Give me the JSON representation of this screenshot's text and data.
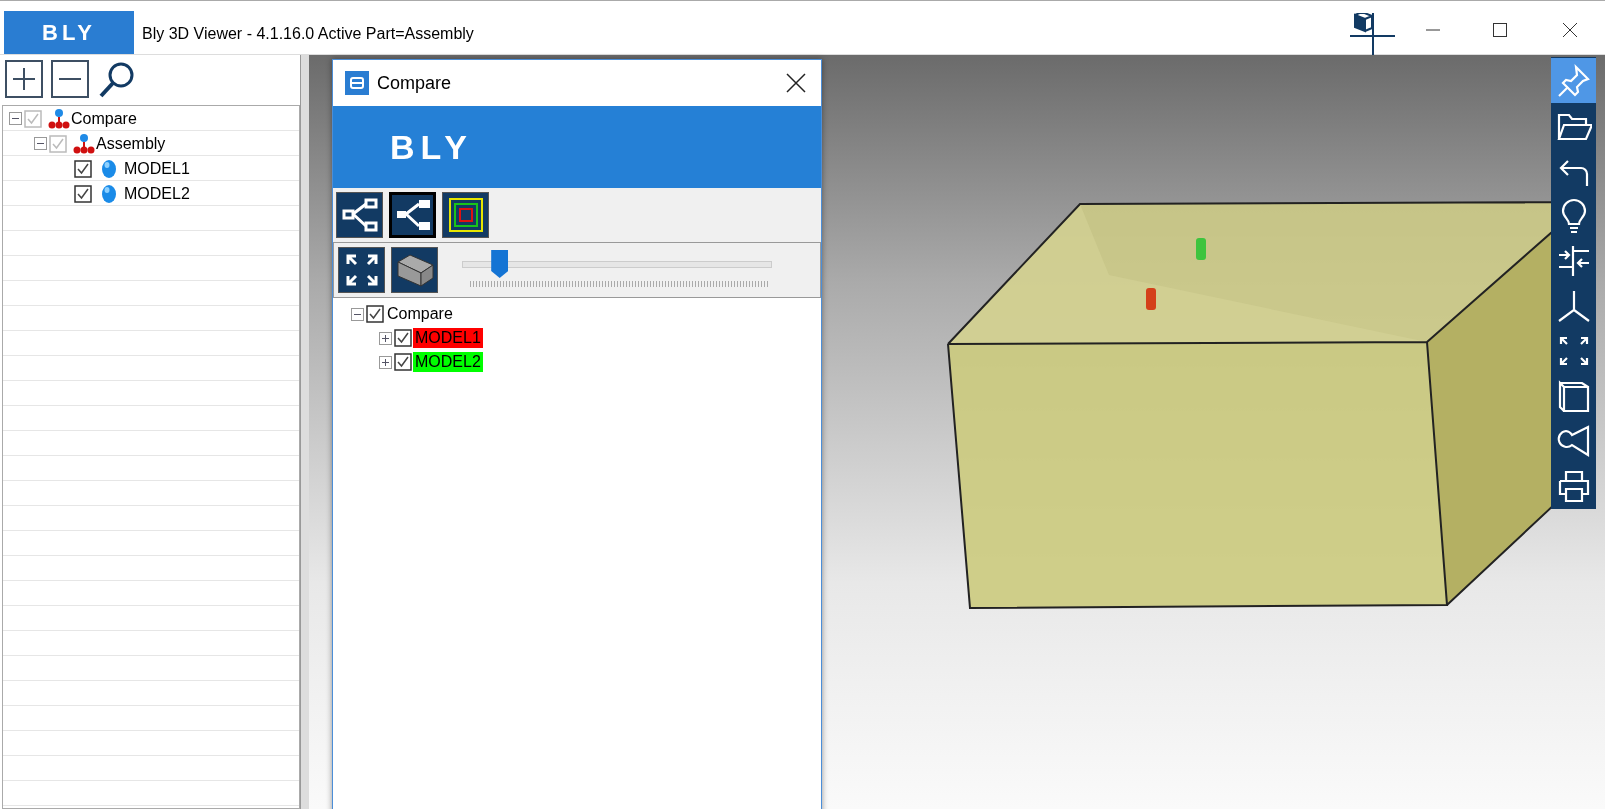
{
  "window": {
    "logo": "BLY",
    "title": "Bly 3D Viewer - 4.1.16.0 Active Part=Assembly"
  },
  "left_tree": [
    {
      "label": "Compare",
      "checked": true,
      "disabled": true,
      "expanded": true,
      "kind": "group",
      "children": [
        {
          "label": "Assembly",
          "checked": true,
          "disabled": true,
          "expanded": true,
          "kind": "group",
          "children": [
            {
              "label": "MODEL1",
              "checked": true,
              "disabled": false,
              "kind": "part"
            },
            {
              "label": "MODEL2",
              "checked": true,
              "disabled": false,
              "kind": "part"
            }
          ]
        }
      ]
    }
  ],
  "compare_dialog": {
    "title": "Compare",
    "logo": "BLY",
    "tool_buttons": [
      {
        "selected": false
      },
      {
        "selected": true
      },
      {
        "selected": false
      }
    ],
    "slider": {
      "level": 0.12
    },
    "tree": [
      {
        "label": "Compare",
        "checked": true,
        "expanded": true,
        "children": [
          {
            "label": "MODEL1",
            "checked": true,
            "expanded": false,
            "color": "#ff0000"
          },
          {
            "label": "MODEL2",
            "checked": true,
            "expanded": false,
            "color": "#00ff00"
          }
        ]
      }
    ]
  },
  "right_toolbar": [
    {
      "selected": true
    },
    {
      "selected": false
    },
    {
      "selected": false
    },
    {
      "selected": false
    },
    {
      "selected": false
    },
    {
      "selected": false
    },
    {
      "selected": false
    },
    {
      "selected": false
    },
    {
      "selected": false
    },
    {
      "selected": false
    }
  ]
}
